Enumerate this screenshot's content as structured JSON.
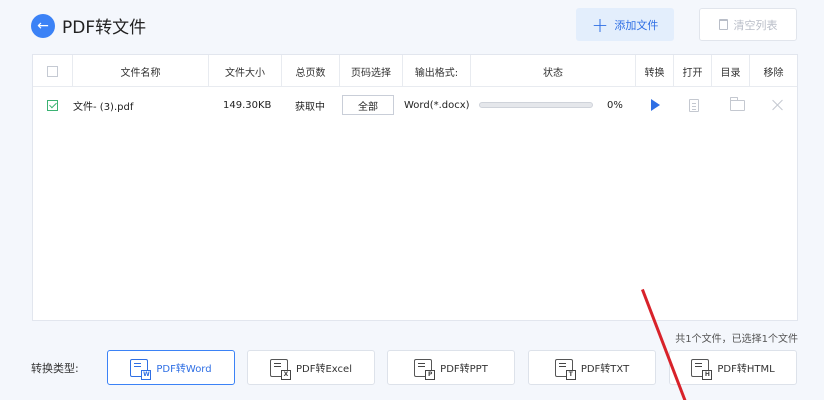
{
  "header": {
    "back_icon": "arrow-left-icon",
    "title": "PDF转文件",
    "add_button": "添加文件",
    "clear_button": "清空列表"
  },
  "table": {
    "columns": [
      "文件名称",
      "文件大小",
      "总页数",
      "页码选择",
      "输出格式:",
      "状态",
      "转换",
      "打开",
      "目录",
      "移除"
    ],
    "rows": [
      {
        "checked": true,
        "name": "文件- (3).pdf",
        "size": "149.30KB",
        "pages": "获取中",
        "page_select": "全部",
        "format": "Word(*.docx)",
        "progress": 0,
        "progress_text": "0%"
      }
    ]
  },
  "summary": "共1个文件，已选择1个文件",
  "conversion": {
    "label": "转换类型:",
    "types": [
      {
        "label": "PDF转Word",
        "badge": "W",
        "active": true
      },
      {
        "label": "PDF转Excel",
        "badge": "X",
        "active": false
      },
      {
        "label": "PDF转PPT",
        "badge": "P",
        "active": false
      },
      {
        "label": "PDF转TXT",
        "badge": "T",
        "active": false
      },
      {
        "label": "PDF转HTML",
        "badge": "H",
        "active": false
      }
    ]
  },
  "colors": {
    "accent": "#3b82f6",
    "annotation_line": "#d8222a"
  }
}
